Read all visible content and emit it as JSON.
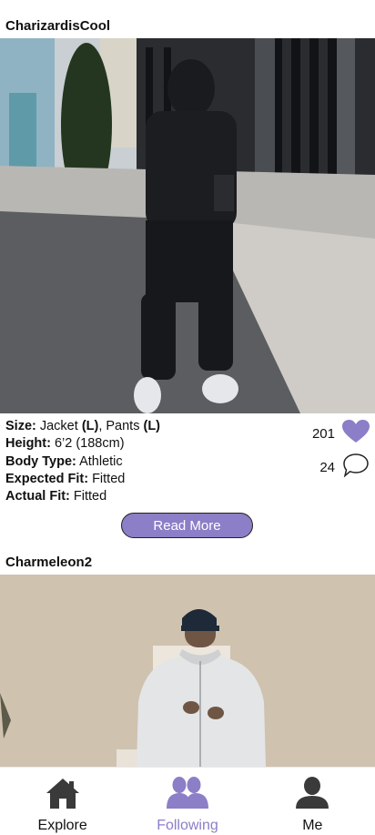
{
  "posts": [
    {
      "username": "CharizardisCool",
      "details": [
        {
          "label": "Size:",
          "parts": [
            {
              "t": " Jacket ",
              "b": false
            },
            {
              "t": "(L)",
              "b": true
            },
            {
              "t": ", Pants ",
              "b": false
            },
            {
              "t": "(L)",
              "b": true
            }
          ]
        },
        {
          "label": "Height:",
          "parts": [
            {
              "t": " 6’2 (188cm)",
              "b": false
            }
          ]
        },
        {
          "label": "Body Type:",
          "parts": [
            {
              "t": " Athletic",
              "b": false
            }
          ]
        },
        {
          "label": "Expected Fit:",
          "parts": [
            {
              "t": " Fitted",
              "b": false
            }
          ]
        },
        {
          "label": "Actual Fit:",
          "parts": [
            {
              "t": " Fitted",
              "b": false
            }
          ]
        }
      ],
      "likes": "201",
      "comments": "24",
      "read_more": "Read More"
    },
    {
      "username": "Charmeleon2"
    }
  ],
  "nav": {
    "items": [
      {
        "label": "Explore",
        "icon": "home-icon",
        "active": false
      },
      {
        "label": "Following",
        "icon": "people-icon",
        "active": true
      },
      {
        "label": "Me",
        "icon": "person-icon",
        "active": false
      }
    ]
  },
  "colors": {
    "accent": "#8c7ec7",
    "text": "#111111",
    "icon_dark": "#3a3a3a"
  }
}
